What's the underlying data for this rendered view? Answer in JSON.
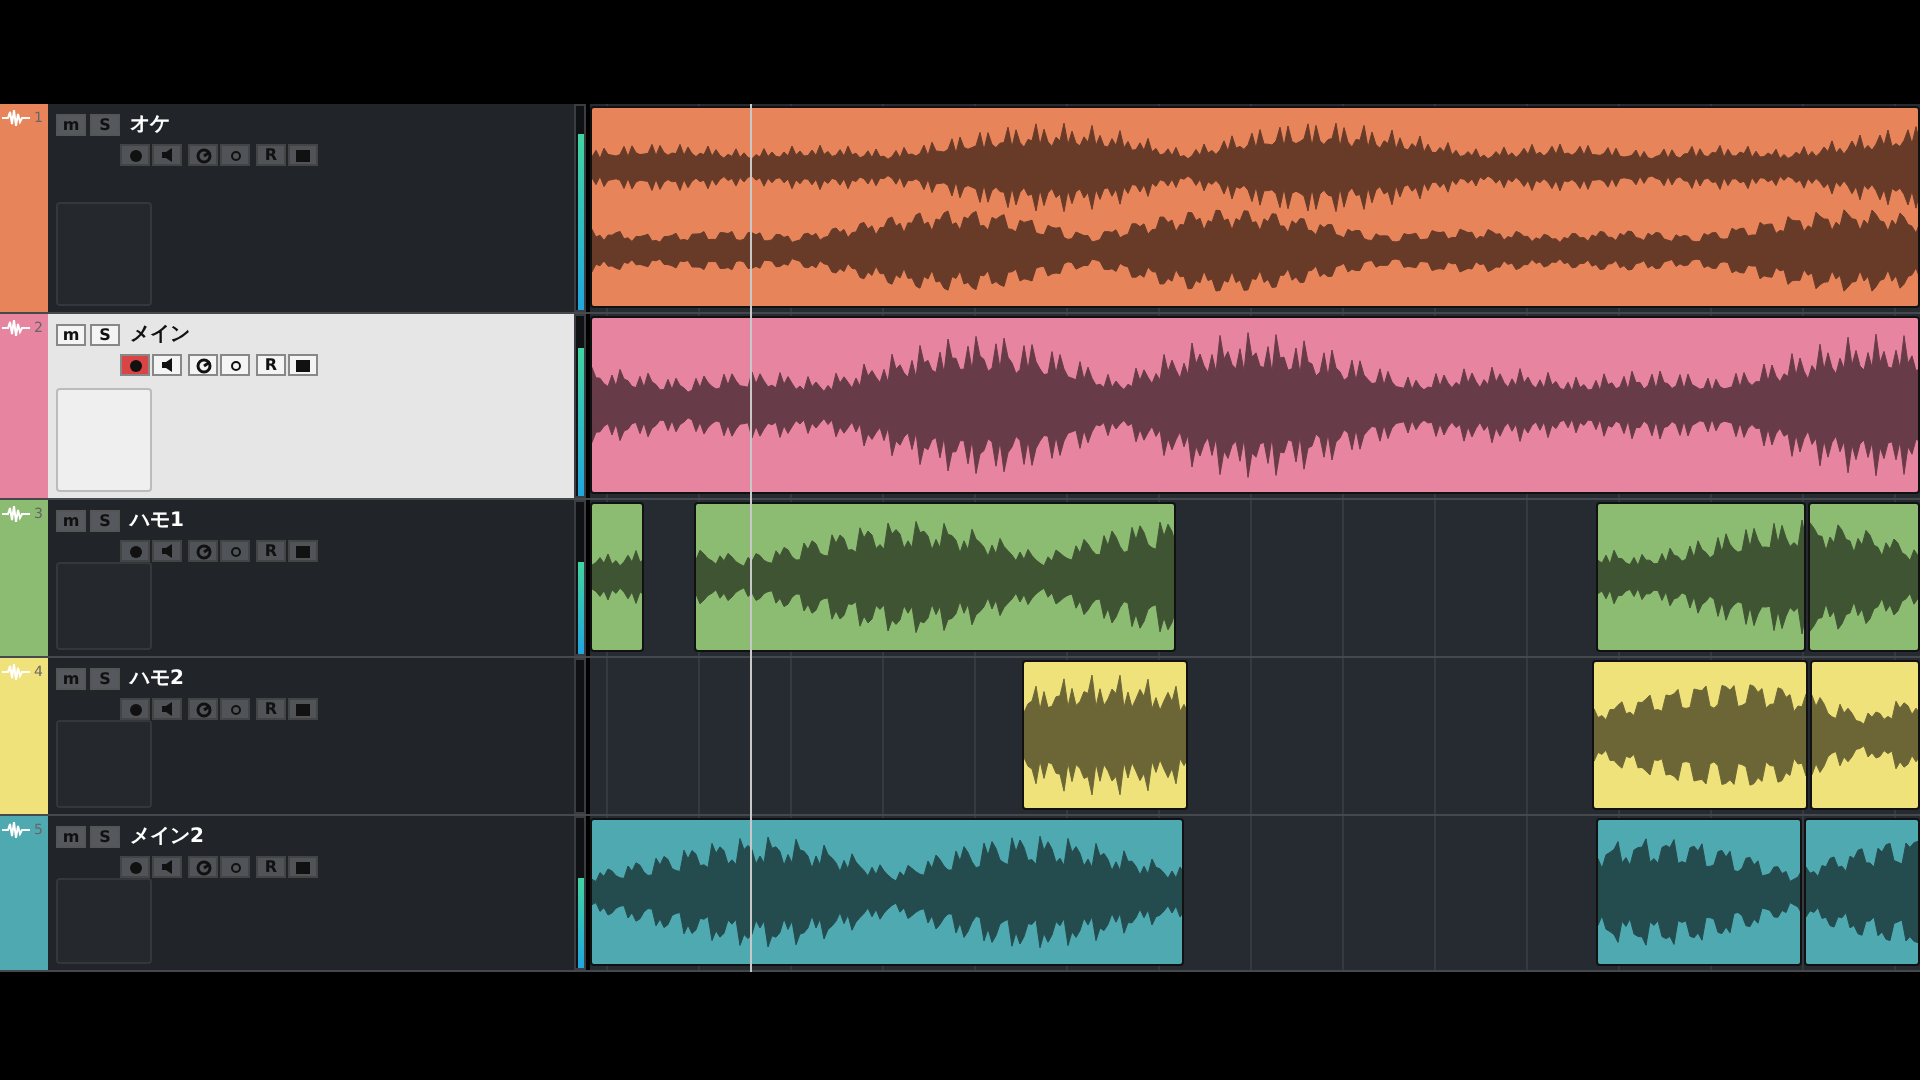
{
  "tracks": [
    {
      "number": "1",
      "name": "オケ",
      "color": "#e8845a",
      "selected": false,
      "record_armed": false,
      "mute": "m",
      "solo": "S",
      "read": "R",
      "meter": {
        "level": 0.86
      }
    },
    {
      "number": "2",
      "name": "メイン",
      "color": "#e784a0",
      "selected": true,
      "record_armed": true,
      "mute": "m",
      "solo": "S",
      "read": "R",
      "meter": {
        "level": 0.82
      }
    },
    {
      "number": "3",
      "name": "ハモ1",
      "color": "#8cbb72",
      "selected": false,
      "record_armed": false,
      "mute": "m",
      "solo": "S",
      "read": "R",
      "meter": {
        "level": 0.6
      }
    },
    {
      "number": "4",
      "name": "ハモ2",
      "color": "#f0e27a",
      "selected": false,
      "record_armed": false,
      "mute": "m",
      "solo": "S",
      "read": "R",
      "meter": {
        "level": 0
      }
    },
    {
      "number": "5",
      "name": "メイン2",
      "color": "#4fa9b0",
      "selected": false,
      "record_armed": false,
      "mute": "m",
      "solo": "S",
      "read": "R",
      "meter": {
        "level": 0.6
      }
    }
  ]
}
